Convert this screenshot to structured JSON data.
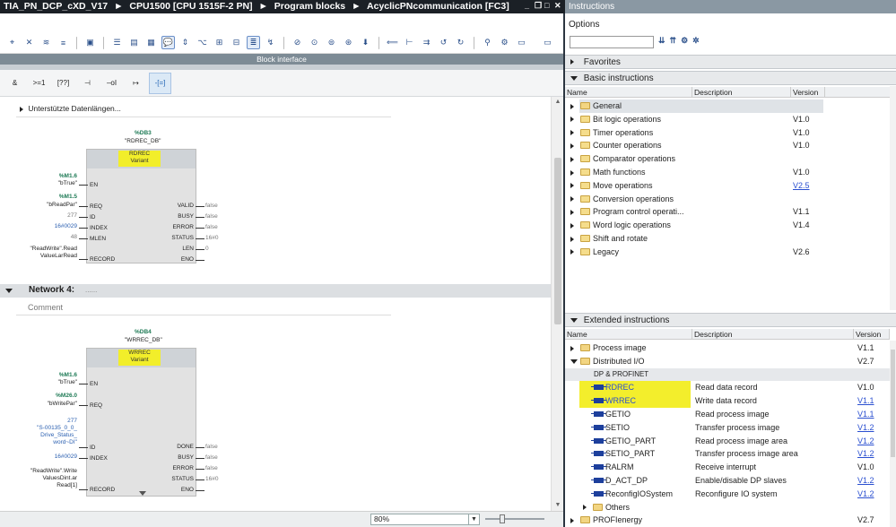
{
  "titlebar": {
    "crumbs": [
      "TIA_PN_DCP_cXD_V17",
      "CPU1500 [CPU 1515F-2 PN]",
      "Program blocks",
      "AcyclicPNcommunication [FC3]"
    ],
    "separator": "►"
  },
  "block_interface": {
    "label": "Block interface"
  },
  "ladder_palette": [
    "&",
    ">=1",
    "[??]",
    "⊣",
    "–oI",
    "↦",
    "-[=]"
  ],
  "canvas": {
    "supported_lengths": "Unterstützte Datenlängen...",
    "block1": {
      "db": "%DB3",
      "db_name": "\"RDREC_DB\"",
      "fb": "RDREC",
      "variant": "Variant",
      "inputs": [
        {
          "addr": "%M1.6",
          "tag": "\"bTrue\"",
          "pin": "EN"
        },
        {
          "addr": "%M1.5",
          "tag": "\"bReadPar\"",
          "pin": "REQ"
        },
        {
          "addr": "",
          "tag": "277",
          "pin": "ID"
        },
        {
          "addr": "",
          "tag": "16#0029",
          "pin": "INDEX"
        },
        {
          "addr": "",
          "tag": "48",
          "pin": "MLEN"
        },
        {
          "addr": "",
          "tag": "\"ReadWrite\".Read\nValueLarRead",
          "pin": "RECORD"
        }
      ],
      "outputs": [
        {
          "pin": "VALID",
          "value": "false"
        },
        {
          "pin": "BUSY",
          "value": "false"
        },
        {
          "pin": "ERROR",
          "value": "false"
        },
        {
          "pin": "STATUS",
          "value": "16#0"
        },
        {
          "pin": "LEN",
          "value": "0"
        },
        {
          "pin": "ENO",
          "value": ""
        }
      ]
    },
    "network4": {
      "label": "Network 4:",
      "title": "......",
      "comment": "Comment"
    },
    "block2": {
      "db": "%DB4",
      "db_name": "\"WRREC_DB\"",
      "fb": "WRREC",
      "variant": "Variant",
      "inputs": [
        {
          "addr": "%M1.6",
          "tag": "\"bTrue\"",
          "pin": "EN"
        },
        {
          "addr": "%M26.0",
          "tag": "\"bWritePar\"",
          "pin": "REQ"
        },
        {
          "addr": "",
          "tag": "277\n\"S-00135_0_0_\nDrive_Status_\nword~DI\"",
          "pin": "ID"
        },
        {
          "addr": "",
          "tag": "16#0029",
          "pin": "INDEX"
        },
        {
          "addr": "",
          "tag": "\"ReadWrite\".Write\nValuesDint.ar\nRead[1]",
          "pin": "RECORD"
        }
      ],
      "outputs": [
        {
          "pin": "DONE",
          "value": "false"
        },
        {
          "pin": "BUSY",
          "value": "false"
        },
        {
          "pin": "ERROR",
          "value": "false"
        },
        {
          "pin": "STATUS",
          "value": "16#0"
        },
        {
          "pin": "ENO",
          "value": ""
        }
      ]
    }
  },
  "statusbar": {
    "zoom": "80%"
  },
  "instructions": {
    "title": "Instructions",
    "options_label": "Options",
    "favorites": "Favorites",
    "basic_title": "Basic instructions",
    "columns": {
      "name": "Name",
      "description": "Description",
      "version": "Version"
    },
    "basic": [
      {
        "name": "General",
        "version": ""
      },
      {
        "name": "Bit logic operations",
        "version": "V1.0"
      },
      {
        "name": "Timer operations",
        "version": "V1.0"
      },
      {
        "name": "Counter operations",
        "version": "V1.0"
      },
      {
        "name": "Comparator operations",
        "version": ""
      },
      {
        "name": "Math functions",
        "version": "V1.0"
      },
      {
        "name": "Move operations",
        "version": "V2.5"
      },
      {
        "name": "Conversion operations",
        "version": ""
      },
      {
        "name": "Program control operati...",
        "version": "V1.1"
      },
      {
        "name": "Word logic operations",
        "version": "V1.4"
      },
      {
        "name": "Shift and rotate",
        "version": ""
      },
      {
        "name": "Legacy",
        "version": "V2.6"
      }
    ],
    "extended_title": "Extended instructions",
    "extended": [
      {
        "name": "Process image",
        "description": "",
        "version": "V1.1"
      },
      {
        "name": "Distributed I/O",
        "description": "",
        "version": "V2.7"
      },
      {
        "name": "DP & PROFINET",
        "description": "",
        "version": ""
      },
      {
        "name": "RDREC",
        "description": "Read data record",
        "version": "V1.0"
      },
      {
        "name": "WRREC",
        "description": "Write data record",
        "version": "V1.1"
      },
      {
        "name": "GETIO",
        "description": "Read process image",
        "version": "V1.1"
      },
      {
        "name": "SETIO",
        "description": "Transfer process image",
        "version": "V1.2"
      },
      {
        "name": "GETIO_PART",
        "description": "Read process image area",
        "version": "V1.2"
      },
      {
        "name": "SETIO_PART",
        "description": "Transfer process image area",
        "version": "V1.2"
      },
      {
        "name": "RALRM",
        "description": "Receive interrupt",
        "version": "V1.0"
      },
      {
        "name": "D_ACT_DP",
        "description": "Enable/disable DP slaves",
        "version": "V1.2"
      },
      {
        "name": "ReconfigIOSystem",
        "description": "Reconfigure IO system",
        "version": "V1.2"
      },
      {
        "name": "Others",
        "description": "",
        "version": ""
      },
      {
        "name": "PROFIenergy",
        "description": "",
        "version": "V2.7"
      }
    ]
  },
  "colors": {
    "highlight": "#f3ee2c",
    "titlebar": "#1b2026",
    "instruction_icon": "#1d3f9c"
  }
}
